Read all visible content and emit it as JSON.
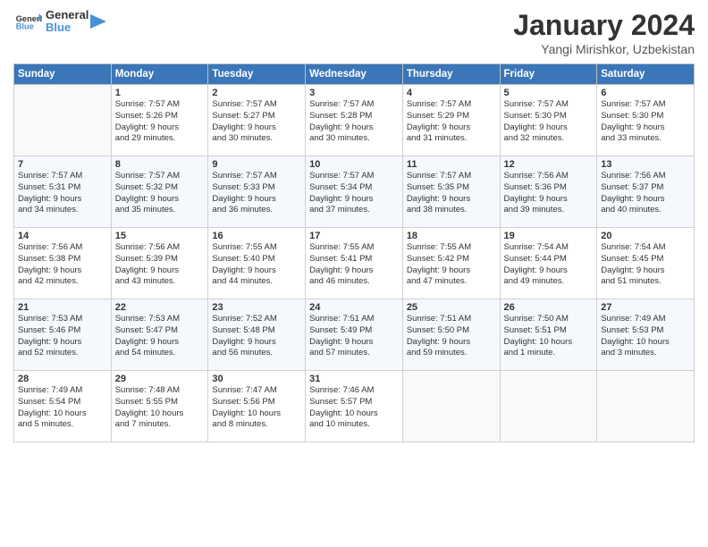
{
  "header": {
    "logo_general": "General",
    "logo_blue": "Blue",
    "month_title": "January 2024",
    "location": "Yangi Mirishkor, Uzbekistan"
  },
  "days_of_week": [
    "Sunday",
    "Monday",
    "Tuesday",
    "Wednesday",
    "Thursday",
    "Friday",
    "Saturday"
  ],
  "weeks": [
    [
      {
        "day": "",
        "empty": true
      },
      {
        "day": "1",
        "sunrise": "Sunrise: 7:57 AM",
        "sunset": "Sunset: 5:26 PM",
        "daylight": "Daylight: 9 hours and 29 minutes."
      },
      {
        "day": "2",
        "sunrise": "Sunrise: 7:57 AM",
        "sunset": "Sunset: 5:27 PM",
        "daylight": "Daylight: 9 hours and 30 minutes."
      },
      {
        "day": "3",
        "sunrise": "Sunrise: 7:57 AM",
        "sunset": "Sunset: 5:28 PM",
        "daylight": "Daylight: 9 hours and 30 minutes."
      },
      {
        "day": "4",
        "sunrise": "Sunrise: 7:57 AM",
        "sunset": "Sunset: 5:29 PM",
        "daylight": "Daylight: 9 hours and 31 minutes."
      },
      {
        "day": "5",
        "sunrise": "Sunrise: 7:57 AM",
        "sunset": "Sunset: 5:30 PM",
        "daylight": "Daylight: 9 hours and 32 minutes."
      },
      {
        "day": "6",
        "sunrise": "Sunrise: 7:57 AM",
        "sunset": "Sunset: 5:30 PM",
        "daylight": "Daylight: 9 hours and 33 minutes."
      }
    ],
    [
      {
        "day": "7",
        "sunrise": "Sunrise: 7:57 AM",
        "sunset": "Sunset: 5:31 PM",
        "daylight": "Daylight: 9 hours and 34 minutes."
      },
      {
        "day": "8",
        "sunrise": "Sunrise: 7:57 AM",
        "sunset": "Sunset: 5:32 PM",
        "daylight": "Daylight: 9 hours and 35 minutes."
      },
      {
        "day": "9",
        "sunrise": "Sunrise: 7:57 AM",
        "sunset": "Sunset: 5:33 PM",
        "daylight": "Daylight: 9 hours and 36 minutes."
      },
      {
        "day": "10",
        "sunrise": "Sunrise: 7:57 AM",
        "sunset": "Sunset: 5:34 PM",
        "daylight": "Daylight: 9 hours and 37 minutes."
      },
      {
        "day": "11",
        "sunrise": "Sunrise: 7:57 AM",
        "sunset": "Sunset: 5:35 PM",
        "daylight": "Daylight: 9 hours and 38 minutes."
      },
      {
        "day": "12",
        "sunrise": "Sunrise: 7:56 AM",
        "sunset": "Sunset: 5:36 PM",
        "daylight": "Daylight: 9 hours and 39 minutes."
      },
      {
        "day": "13",
        "sunrise": "Sunrise: 7:56 AM",
        "sunset": "Sunset: 5:37 PM",
        "daylight": "Daylight: 9 hours and 40 minutes."
      }
    ],
    [
      {
        "day": "14",
        "sunrise": "Sunrise: 7:56 AM",
        "sunset": "Sunset: 5:38 PM",
        "daylight": "Daylight: 9 hours and 42 minutes."
      },
      {
        "day": "15",
        "sunrise": "Sunrise: 7:56 AM",
        "sunset": "Sunset: 5:39 PM",
        "daylight": "Daylight: 9 hours and 43 minutes."
      },
      {
        "day": "16",
        "sunrise": "Sunrise: 7:55 AM",
        "sunset": "Sunset: 5:40 PM",
        "daylight": "Daylight: 9 hours and 44 minutes."
      },
      {
        "day": "17",
        "sunrise": "Sunrise: 7:55 AM",
        "sunset": "Sunset: 5:41 PM",
        "daylight": "Daylight: 9 hours and 46 minutes."
      },
      {
        "day": "18",
        "sunrise": "Sunrise: 7:55 AM",
        "sunset": "Sunset: 5:42 PM",
        "daylight": "Daylight: 9 hours and 47 minutes."
      },
      {
        "day": "19",
        "sunrise": "Sunrise: 7:54 AM",
        "sunset": "Sunset: 5:44 PM",
        "daylight": "Daylight: 9 hours and 49 minutes."
      },
      {
        "day": "20",
        "sunrise": "Sunrise: 7:54 AM",
        "sunset": "Sunset: 5:45 PM",
        "daylight": "Daylight: 9 hours and 51 minutes."
      }
    ],
    [
      {
        "day": "21",
        "sunrise": "Sunrise: 7:53 AM",
        "sunset": "Sunset: 5:46 PM",
        "daylight": "Daylight: 9 hours and 52 minutes."
      },
      {
        "day": "22",
        "sunrise": "Sunrise: 7:53 AM",
        "sunset": "Sunset: 5:47 PM",
        "daylight": "Daylight: 9 hours and 54 minutes."
      },
      {
        "day": "23",
        "sunrise": "Sunrise: 7:52 AM",
        "sunset": "Sunset: 5:48 PM",
        "daylight": "Daylight: 9 hours and 56 minutes."
      },
      {
        "day": "24",
        "sunrise": "Sunrise: 7:51 AM",
        "sunset": "Sunset: 5:49 PM",
        "daylight": "Daylight: 9 hours and 57 minutes."
      },
      {
        "day": "25",
        "sunrise": "Sunrise: 7:51 AM",
        "sunset": "Sunset: 5:50 PM",
        "daylight": "Daylight: 9 hours and 59 minutes."
      },
      {
        "day": "26",
        "sunrise": "Sunrise: 7:50 AM",
        "sunset": "Sunset: 5:51 PM",
        "daylight": "Daylight: 10 hours and 1 minute."
      },
      {
        "day": "27",
        "sunrise": "Sunrise: 7:49 AM",
        "sunset": "Sunset: 5:53 PM",
        "daylight": "Daylight: 10 hours and 3 minutes."
      }
    ],
    [
      {
        "day": "28",
        "sunrise": "Sunrise: 7:49 AM",
        "sunset": "Sunset: 5:54 PM",
        "daylight": "Daylight: 10 hours and 5 minutes."
      },
      {
        "day": "29",
        "sunrise": "Sunrise: 7:48 AM",
        "sunset": "Sunset: 5:55 PM",
        "daylight": "Daylight: 10 hours and 7 minutes."
      },
      {
        "day": "30",
        "sunrise": "Sunrise: 7:47 AM",
        "sunset": "Sunset: 5:56 PM",
        "daylight": "Daylight: 10 hours and 8 minutes."
      },
      {
        "day": "31",
        "sunrise": "Sunrise: 7:46 AM",
        "sunset": "Sunset: 5:57 PM",
        "daylight": "Daylight: 10 hours and 10 minutes."
      },
      {
        "day": "",
        "empty": true
      },
      {
        "day": "",
        "empty": true
      },
      {
        "day": "",
        "empty": true
      }
    ]
  ]
}
